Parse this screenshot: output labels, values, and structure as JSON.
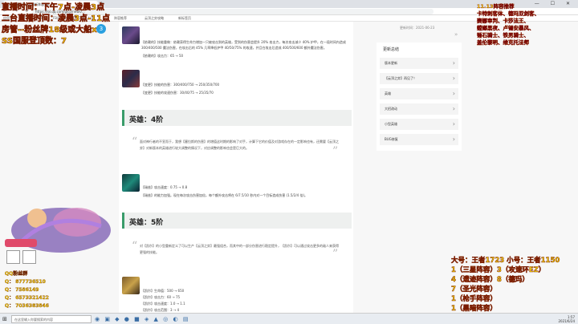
{
  "browser": {
    "tabs": [
      "英雄联盟云顶之弈最新阵容_神..."
    ],
    "tab_add": "+",
    "url": "https://lol.qq.com/gicp/news/...",
    "bookmarks": [
      "应用",
      "TFT Classes 4/1",
      "FB问题库",
      "TFT Tiers_List",
      "阵容推荐",
      "云顶之弈攻略",
      "新标签页"
    ],
    "win_controls": "— ☐ ✕"
  },
  "article": {
    "date": "更新时间：2021-06-23",
    "block1": {
      "lines": [
        "【依赖的】技能重做：依赖获得生命力增加一只被攻击到的英雄，受到的伤害会提升 20% 攻击力，每次攻击减少 40% 护甲，在一段时间内造成 300/400/500 魔法伤害，在攻击后的 45% 几率降低护甲 40/50/75% 的攻速，并且在攻击后造成 400/500/600 额外魔法伤害。",
        "【依赖的】攻击力：65 → 50"
      ]
    },
    "block2": {
      "lines": [
        "【变更】技能的伤害：300/400/750 → 250/350/700",
        "【变更】技能的攻速伤害：30/40/75 → 25/35/70"
      ]
    },
    "section4": {
      "title": "英雄：4阶"
    },
    "quote4": "面对神行者的不宣而于，我想【塞拉斯的伤害】的增值这时期的影响了对手，计算下它的价值及对游戏存在的一定影响也有，还需要【云顶之弈】对新版本的英雄进行较大调整的情况下，对应调整的影响也会是巨大的。",
    "block3": {
      "lines": [
        "【瑞兹】攻击速度：0.75 → 0.8",
        "【瑞兹】的能力加强。现在每次攻击伤害加倍，每个额外攻击将在 6/7.5/10 秒内对一个目标造成伤害 (1.5/2/4 倍)。"
      ]
    },
    "section5": {
      "title": "英雄：5阶"
    },
    "quote5": "对【凯尔】的小型重新定义了可以生产【云顶之弈】最强组合，而其中的一部分伤害进行稳定提升，【凯尔】可以通过攻击更多的敌人来获得更强的技能。",
    "block4": {
      "lines": [
        "【凯尔】生命值：500 → 650",
        "【凯尔】攻击力：60 → 75",
        "【凯尔】攻击速度：1.0 → 1.1",
        "【凯尔】攻击范围：3 → 4"
      ]
    }
  },
  "sidebar": {
    "title": "更新总结",
    "items": [
      "版本更新",
      "【云顶之弈】再见了！",
      "英雄",
      "大招改动",
      "小型英雄",
      "BUG修复"
    ]
  },
  "taskbar": {
    "search_placeholder": "在这里输入你要搜索的内容",
    "time": "1:57",
    "date": "2021/6/24"
  },
  "overlay": {
    "line1": "直播时间：下午7点-凌晨3点",
    "line2": "二台直播时间：凌晨3点-11点",
    "line3": "房管--粉丝牌18级或大船x1",
    "line4": "SS国服登顶数：7",
    "right_lines": [
      "11.13阵容推荐",
      "卡特刺客体、德玛双剑客、",
      "赛娜审判、卡莎法王、",
      "螳螂黑夜、卢锡安暴风、",
      "锤石骑士、铁男骑士、",
      "盖伦黎明、维克托法师"
    ],
    "contacts": [
      "QQ粉丝群",
      "Q： 877736510",
      "Q： 7586149",
      "Q： 6573321422",
      "Q： 7036383846"
    ],
    "ranking": [
      "大号：王者1723 小号：王者1150",
      "1（三星阵容）3（攻速环EZ）",
      "4（遗迹阵容）8（德玛）",
      "7（圣光阵容）",
      "1（枪手阵容）",
      "1（黑暗阵容）"
    ]
  }
}
